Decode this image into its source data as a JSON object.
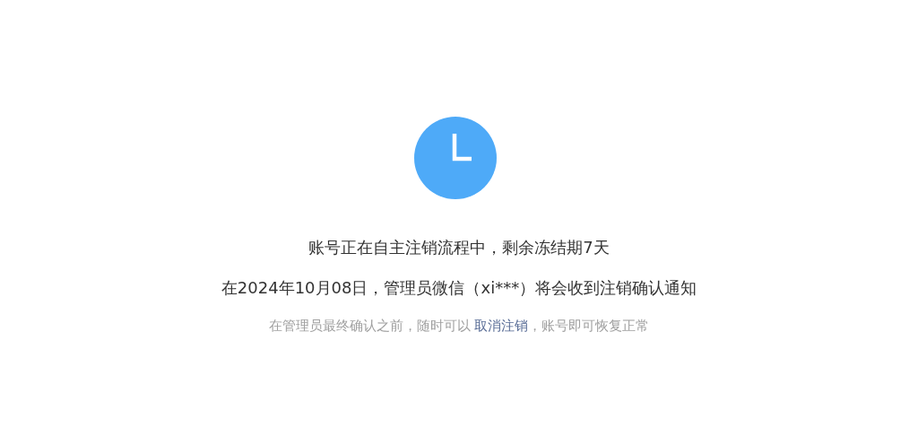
{
  "status": {
    "title": "账号正在自主注销流程中，剩余冻结期7天",
    "detail": "在2024年10月08日，管理员微信（xi***）将会收到注销确认通知",
    "note": {
      "before": "在管理员最终确认之前，随时可以 ",
      "link": "取消注销",
      "after": "，账号即可恢复正常"
    }
  }
}
